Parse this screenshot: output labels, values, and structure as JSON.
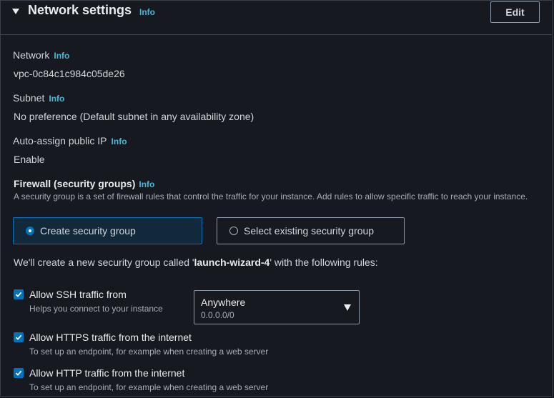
{
  "header": {
    "title": "Network settings",
    "info": "Info",
    "edit_label": "Edit",
    "caret_icon": "caret-down-icon"
  },
  "network": {
    "label": "Network",
    "info": "Info",
    "value": "vpc-0c84c1c984c05de26"
  },
  "subnet": {
    "label": "Subnet",
    "info": "Info",
    "value": "No preference (Default subnet in any availability zone)"
  },
  "public_ip": {
    "label": "Auto-assign public IP",
    "info": "Info",
    "value": "Enable"
  },
  "firewall": {
    "title": "Firewall (security groups)",
    "info": "Info",
    "description": "A security group is a set of firewall rules that control the traffic for your instance. Add rules to allow specific traffic to reach your instance.",
    "options": [
      {
        "label": "Create security group",
        "selected": true
      },
      {
        "label": "Select existing security group",
        "selected": false
      }
    ],
    "note_prefix": "We'll create a new security group called '",
    "group_name": "launch-wizard-4",
    "note_suffix": "' with the following rules:"
  },
  "rules": [
    {
      "label": "Allow SSH traffic from",
      "description": "Helps you connect to your instance",
      "checked": true
    },
    {
      "label": "Allow HTTPS traffic from the internet",
      "description": "To set up an endpoint, for example when creating a web server",
      "checked": true
    },
    {
      "label": "Allow HTTP traffic from the internet",
      "description": "To set up an endpoint, for example when creating a web server",
      "checked": true
    }
  ],
  "ssh_source": {
    "value": "Anywhere",
    "sub": "0.0.0.0/0"
  },
  "colors": {
    "background": "#16191f",
    "accent": "#0073bb",
    "info_link": "#44b9d6",
    "selected_card_bg": "#12293b",
    "border": "#8d99a8"
  }
}
